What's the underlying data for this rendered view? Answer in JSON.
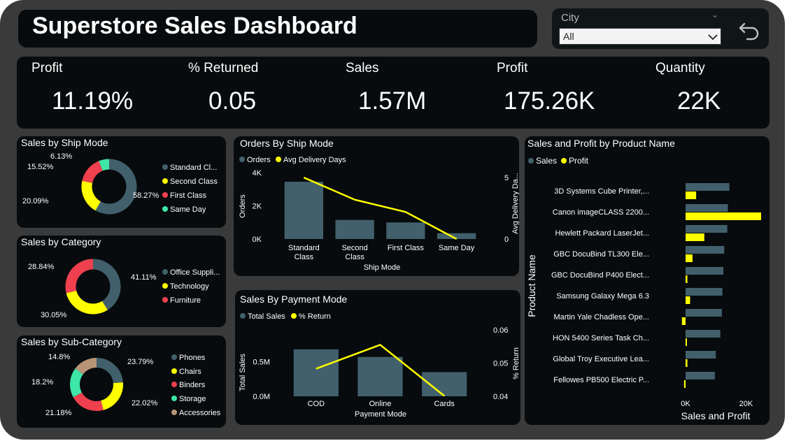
{
  "header": {
    "title": "Superstore Sales Dashboard"
  },
  "filter": {
    "label": "City",
    "value": "All"
  },
  "kpis": [
    {
      "label": "Profit",
      "value": "11.19%"
    },
    {
      "label": "% Returned",
      "value": "0.05"
    },
    {
      "label": "Sales",
      "value": "1.57M"
    },
    {
      "label": "Profit",
      "value": "175.26K"
    },
    {
      "label": "Quantity",
      "value": "22K"
    }
  ],
  "colors": {
    "teal": "#41606c",
    "yellow": "#ffff00",
    "red": "#ef4050",
    "green": "#3ee6a8",
    "tan": "#b89477"
  },
  "chart_data": [
    {
      "type": "pie",
      "title": "Sales by Ship Mode",
      "slices": [
        {
          "name": "Standard Cl...",
          "value": 58.27,
          "label": "58.27%",
          "color": "#41606c"
        },
        {
          "name": "Second Class",
          "value": 20.09,
          "label": "20.09%",
          "color": "#ffff00"
        },
        {
          "name": "First Class",
          "value": 15.52,
          "label": "15.52%",
          "color": "#ef4050"
        },
        {
          "name": "Same Day",
          "value": 6.13,
          "label": "6.13%",
          "color": "#3ee6a8"
        }
      ]
    },
    {
      "type": "pie",
      "title": "Sales by Category",
      "slices": [
        {
          "name": "Office Suppli...",
          "value": 41.11,
          "label": "41.11%",
          "color": "#41606c"
        },
        {
          "name": "Technology",
          "value": 30.05,
          "label": "30.05%",
          "color": "#ffff00"
        },
        {
          "name": "Furniture",
          "value": 28.84,
          "label": "28.84%",
          "color": "#ef4050"
        }
      ]
    },
    {
      "type": "pie",
      "title": "Sales by Sub-Category",
      "slices": [
        {
          "name": "Phones",
          "value": 23.79,
          "label": "23.79%",
          "color": "#41606c"
        },
        {
          "name": "Chairs",
          "value": 22.02,
          "label": "22.02%",
          "color": "#ffff00"
        },
        {
          "name": "Binders",
          "value": 21.18,
          "label": "21.18%",
          "color": "#ef4050"
        },
        {
          "name": "Storage",
          "value": 18.2,
          "label": "18.2%",
          "color": "#3ee6a8"
        },
        {
          "name": "Accessories",
          "value": 14.8,
          "label": "14.8%",
          "color": "#b89477"
        }
      ]
    },
    {
      "type": "bar",
      "title": "Orders By Ship Mode",
      "categories": [
        "Standard Class",
        "Second Class",
        "First Class",
        "Same Day"
      ],
      "category_lines": [
        [
          "Standard",
          "Class"
        ],
        [
          "Second",
          "Class"
        ],
        [
          "First Class"
        ],
        [
          "Same Day"
        ]
      ],
      "series": [
        {
          "name": "Orders",
          "values": [
            3450,
            1150,
            1000,
            350
          ],
          "color": "#41606c"
        },
        {
          "name": "Avg Delivery Days",
          "values": [
            5.0,
            3.2,
            2.2,
            0.0
          ],
          "color": "#ffff00"
        }
      ],
      "xlabel": "Ship Mode",
      "ylabel": "Orders",
      "y2label": "Avg Delivery Da...",
      "ylim": [
        0,
        4000
      ],
      "yticks": [
        {
          "v": 0,
          "t": "0K"
        },
        {
          "v": 2000,
          "t": "2K"
        },
        {
          "v": 4000,
          "t": "4K"
        }
      ],
      "y2lim": [
        0,
        5.8
      ],
      "y2ticks": [
        {
          "v": 0,
          "t": "0"
        },
        {
          "v": 5,
          "t": "5"
        }
      ]
    },
    {
      "type": "bar",
      "title": "Sales By Payment Mode",
      "categories": [
        "COD",
        "Online",
        "Cards"
      ],
      "series": [
        {
          "name": "Total Sales",
          "values": [
            0.68,
            0.57,
            0.35
          ],
          "color": "#41606c"
        },
        {
          "name": "% Return",
          "values": [
            0.0483,
            0.0555,
            0.0401
          ],
          "color": "#ffff00"
        }
      ],
      "xlabel": "Payment Mode",
      "ylabel": "Total Sales",
      "y2label": "% Return",
      "ylim": [
        0,
        0.8
      ],
      "yticks": [
        {
          "v": 0,
          "t": "0.0M"
        },
        {
          "v": 0.5,
          "t": "0.5M"
        }
      ],
      "y2lim": [
        0.04,
        0.06
      ],
      "y2ticks": [
        {
          "v": 0.04,
          "t": "0.04"
        },
        {
          "v": 0.05,
          "t": "0.05"
        },
        {
          "v": 0.06,
          "t": "0.06"
        }
      ]
    },
    {
      "type": "bar",
      "title": "Sales and Profit by Product Name",
      "categories": [
        "3D Systems Cube Printer,...",
        "Canon imageCLASS 2200...",
        "Hewlett Packard LaserJet...",
        "GBC DocuBind TL300 Ele...",
        "GBC DocuBind P400 Elect...",
        "Samsung Galaxy Mega 6.3",
        "Martin Yale Chadless Ope...",
        "HON 5400 Series Task Ch...",
        "Global Troy Executive Lea...",
        "Fellowes PB500 Electric P..."
      ],
      "series": [
        {
          "name": "Sales",
          "values": [
            14500,
            14000,
            13800,
            12800,
            12500,
            12200,
            12000,
            11500,
            10000,
            9700
          ],
          "color": "#41606c"
        },
        {
          "name": "Profit",
          "values": [
            3500,
            25000,
            6200,
            2300,
            600,
            1500,
            -1200,
            300,
            600,
            -500
          ],
          "color": "#ffff00"
        }
      ],
      "xlabel": "Sales and Profit",
      "ylabel": "Product Name",
      "xlim": [
        -2000,
        25500
      ],
      "xticks": [
        {
          "v": 0,
          "t": "0K"
        },
        {
          "v": 20000,
          "t": "20K"
        }
      ]
    }
  ]
}
